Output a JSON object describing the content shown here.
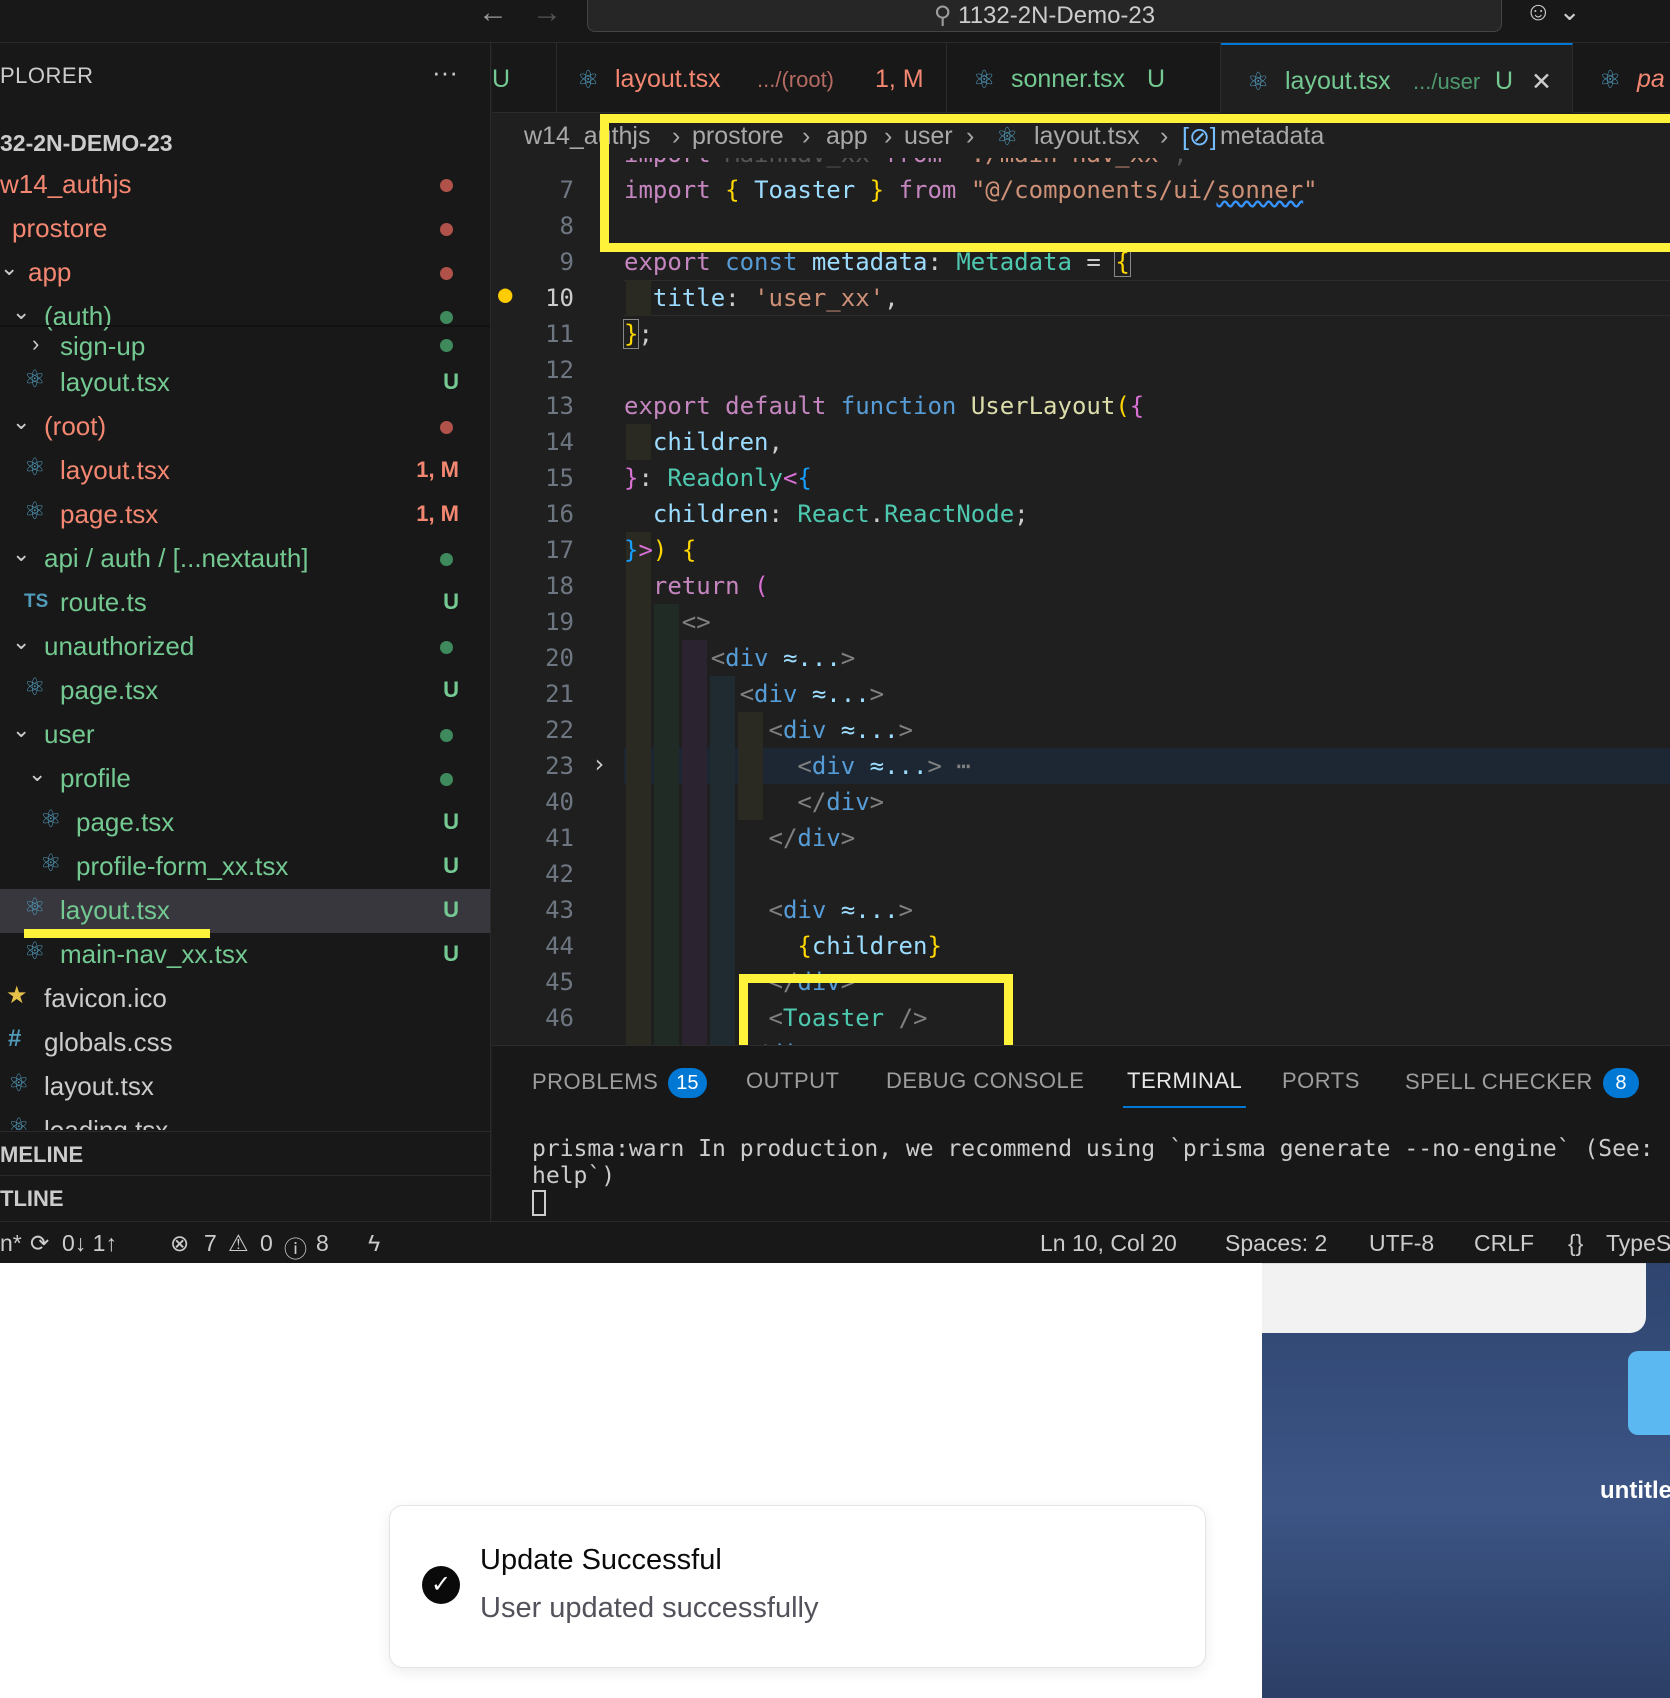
{
  "titlebar": {
    "search_text": "1132-2N-Demo-23"
  },
  "explorer": {
    "header": "PLORER",
    "workspace": "32-2N-DEMO-23",
    "items": [
      {
        "label": "w14_authjs",
        "status": ""
      },
      {
        "label": "prostore",
        "status": ""
      },
      {
        "label": "app",
        "status": ""
      },
      {
        "label": "(auth)",
        "status": ""
      },
      {
        "label": "sign-up",
        "status": ""
      },
      {
        "label": "layout.tsx",
        "status": "U"
      },
      {
        "label": "(root)",
        "status": ""
      },
      {
        "label": "layout.tsx",
        "status": "1, M"
      },
      {
        "label": "page.tsx",
        "status": "1, M"
      },
      {
        "label": "api / auth / [...nextauth]",
        "status": ""
      },
      {
        "label": "route.ts",
        "status": "U",
        "icon_text": "TS"
      },
      {
        "label": "unauthorized",
        "status": ""
      },
      {
        "label": "page.tsx",
        "status": "U"
      },
      {
        "label": "user",
        "status": ""
      },
      {
        "label": "profile",
        "status": ""
      },
      {
        "label": "page.tsx",
        "status": "U"
      },
      {
        "label": "profile-form_xx.tsx",
        "status": "U"
      },
      {
        "label": "layout.tsx",
        "status": "U"
      },
      {
        "label": "main-nav_xx.tsx",
        "status": "U"
      },
      {
        "label": "favicon.ico",
        "status": ""
      },
      {
        "label": "globals.css",
        "status": ""
      },
      {
        "label": "layout.tsx",
        "status": ""
      },
      {
        "label": "loading.tsx",
        "status": ""
      }
    ],
    "sections": [
      "MELINE",
      "TLINE"
    ]
  },
  "tabs": [
    {
      "partial": "U"
    },
    {
      "name": "layout.tsx",
      "path": ".../(root)",
      "status": "1, M"
    },
    {
      "name": "sonner.tsx",
      "status": "U"
    },
    {
      "name": "layout.tsx",
      "path": ".../user",
      "status": "U",
      "close": "✕"
    },
    {
      "partial": "pa"
    }
  ],
  "breadcrumb": [
    "w14_authjs",
    "prostore",
    "app",
    "user",
    "layout.tsx",
    "metadata"
  ],
  "editor": {
    "line_numbers": [
      "7",
      "8",
      "9",
      "10",
      "11",
      "12",
      "13",
      "14",
      "15",
      "16",
      "17",
      "18",
      "19",
      "20",
      "21",
      "22",
      "23",
      "40",
      "41",
      "42",
      "43",
      "44",
      "45",
      "46"
    ]
  },
  "panel": {
    "tabs": [
      {
        "label": "PROBLEMS",
        "badge": "15"
      },
      {
        "label": "OUTPUT"
      },
      {
        "label": "DEBUG CONSOLE"
      },
      {
        "label": "TERMINAL"
      },
      {
        "label": "PORTS"
      },
      {
        "label": "SPELL CHECKER",
        "badge": "8"
      }
    ],
    "terminal_line1": "prisma:warn In production, we recommend using `prisma generate --no-engine` (See:",
    "terminal_line2": "help`)"
  },
  "statusbar": {
    "branch": "n*",
    "sync": "0↓ 1↑",
    "errors": "7",
    "warnings": "0",
    "info": "8",
    "position": "Ln 10, Col 20",
    "spaces": "Spaces: 2",
    "encoding": "UTF-8",
    "eol": "CRLF",
    "language": "TypeS"
  },
  "toast": {
    "title": "Update Successful",
    "description": "User updated successfully"
  },
  "desktop": {
    "folder_label": "untitle"
  },
  "colors": {
    "highlight": "#fff23a",
    "accent": "#0078d4",
    "untracked": "#73c991",
    "modified": "#f48771"
  }
}
